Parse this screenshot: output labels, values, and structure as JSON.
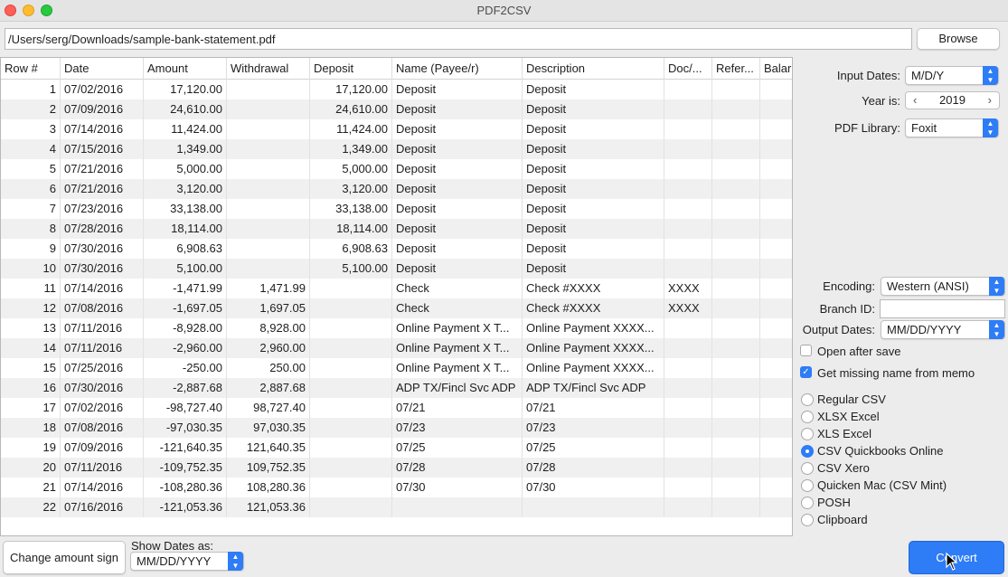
{
  "window": {
    "title": "PDF2CSV"
  },
  "file": {
    "path": "/Users/serg/Downloads/sample-bank-statement.pdf",
    "browse_label": "Browse"
  },
  "table": {
    "columns": [
      "Row #",
      "Date",
      "Amount",
      "Withdrawal",
      "Deposit",
      "Name (Payee/r)",
      "Description",
      "Doc/...",
      "Refer...",
      "Balar"
    ],
    "rows": [
      [
        "1",
        "07/02/2016",
        "17,120.00",
        "",
        "17,120.00",
        "Deposit",
        "Deposit",
        "",
        "",
        ""
      ],
      [
        "2",
        "07/09/2016",
        "24,610.00",
        "",
        "24,610.00",
        "Deposit",
        "Deposit",
        "",
        "",
        ""
      ],
      [
        "3",
        "07/14/2016",
        "11,424.00",
        "",
        "11,424.00",
        "Deposit",
        "Deposit",
        "",
        "",
        ""
      ],
      [
        "4",
        "07/15/2016",
        "1,349.00",
        "",
        "1,349.00",
        "Deposit",
        "Deposit",
        "",
        "",
        ""
      ],
      [
        "5",
        "07/21/2016",
        "5,000.00",
        "",
        "5,000.00",
        "Deposit",
        "Deposit",
        "",
        "",
        ""
      ],
      [
        "6",
        "07/21/2016",
        "3,120.00",
        "",
        "3,120.00",
        "Deposit",
        "Deposit",
        "",
        "",
        ""
      ],
      [
        "7",
        "07/23/2016",
        "33,138.00",
        "",
        "33,138.00",
        "Deposit",
        "Deposit",
        "",
        "",
        ""
      ],
      [
        "8",
        "07/28/2016",
        "18,114.00",
        "",
        "18,114.00",
        "Deposit",
        "Deposit",
        "",
        "",
        ""
      ],
      [
        "9",
        "07/30/2016",
        "6,908.63",
        "",
        "6,908.63",
        "Deposit",
        "Deposit",
        "",
        "",
        ""
      ],
      [
        "10",
        "07/30/2016",
        "5,100.00",
        "",
        "5,100.00",
        "Deposit",
        "Deposit",
        "",
        "",
        ""
      ],
      [
        "11",
        "07/14/2016",
        "-1,471.99",
        "1,471.99",
        "",
        "Check",
        "Check #XXXX",
        "XXXX",
        "",
        ""
      ],
      [
        "12",
        "07/08/2016",
        "-1,697.05",
        "1,697.05",
        "",
        "Check",
        "Check #XXXX",
        "XXXX",
        "",
        ""
      ],
      [
        "13",
        "07/11/2016",
        "-8,928.00",
        "8,928.00",
        "",
        "Online Payment X T...",
        "Online Payment XXXX...",
        "",
        "",
        ""
      ],
      [
        "14",
        "07/11/2016",
        "-2,960.00",
        "2,960.00",
        "",
        "Online Payment X T...",
        "Online Payment XXXX...",
        "",
        "",
        ""
      ],
      [
        "15",
        "07/25/2016",
        "-250.00",
        "250.00",
        "",
        "Online Payment X T...",
        "Online Payment XXXX...",
        "",
        "",
        ""
      ],
      [
        "16",
        "07/30/2016",
        "-2,887.68",
        "2,887.68",
        "",
        "ADP TX/Fincl Svc ADP",
        "ADP TX/Fincl Svc ADP",
        "",
        "",
        ""
      ],
      [
        "17",
        "07/02/2016",
        "-98,727.40",
        "98,727.40",
        "",
        "07/21",
        "07/21",
        "",
        "",
        ""
      ],
      [
        "18",
        "07/08/2016",
        "-97,030.35",
        "97,030.35",
        "",
        "07/23",
        "07/23",
        "",
        "",
        ""
      ],
      [
        "19",
        "07/09/2016",
        "-121,640.35",
        "121,640.35",
        "",
        "07/25",
        "07/25",
        "",
        "",
        ""
      ],
      [
        "20",
        "07/11/2016",
        "-109,752.35",
        "109,752.35",
        "",
        "07/28",
        "07/28",
        "",
        "",
        ""
      ],
      [
        "21",
        "07/14/2016",
        "-108,280.36",
        "108,280.36",
        "",
        "07/30",
        "07/30",
        "",
        "",
        ""
      ],
      [
        "22",
        "07/16/2016",
        "-121,053.36",
        "121,053.36",
        "",
        "",
        "",
        "",
        "",
        ""
      ]
    ]
  },
  "settings": {
    "input_dates_label": "Input Dates:",
    "input_dates_value": "M/D/Y",
    "year_label": "Year is:",
    "year_value": "2019",
    "pdf_library_label": "PDF Library:",
    "pdf_library_value": "Foxit",
    "encoding_label": "Encoding:",
    "encoding_value": "Western (ANSI)",
    "branch_label": "Branch ID:",
    "branch_value": "",
    "output_dates_label": "Output Dates:",
    "output_dates_value": "MM/DD/YYYY",
    "open_after_save_label": "Open after save",
    "open_after_save_checked": false,
    "missing_name_label": "Get missing name from memo",
    "missing_name_checked": true
  },
  "formats": {
    "selected": "CSV Quickbooks Online",
    "options": [
      "Regular CSV",
      "XLSX Excel",
      "XLS Excel",
      "CSV Quickbooks Online",
      "CSV Xero",
      "Quicken Mac (CSV Mint)",
      "POSH",
      "Clipboard"
    ]
  },
  "footer": {
    "change_amount_sign_label": "Change amount sign",
    "show_dates_label": "Show Dates as:",
    "show_dates_value": "MM/DD/YYYY",
    "convert_label": "Convert"
  },
  "colors": {
    "accent": "#2e7cf6",
    "row_alt": "#f0f0f0"
  }
}
